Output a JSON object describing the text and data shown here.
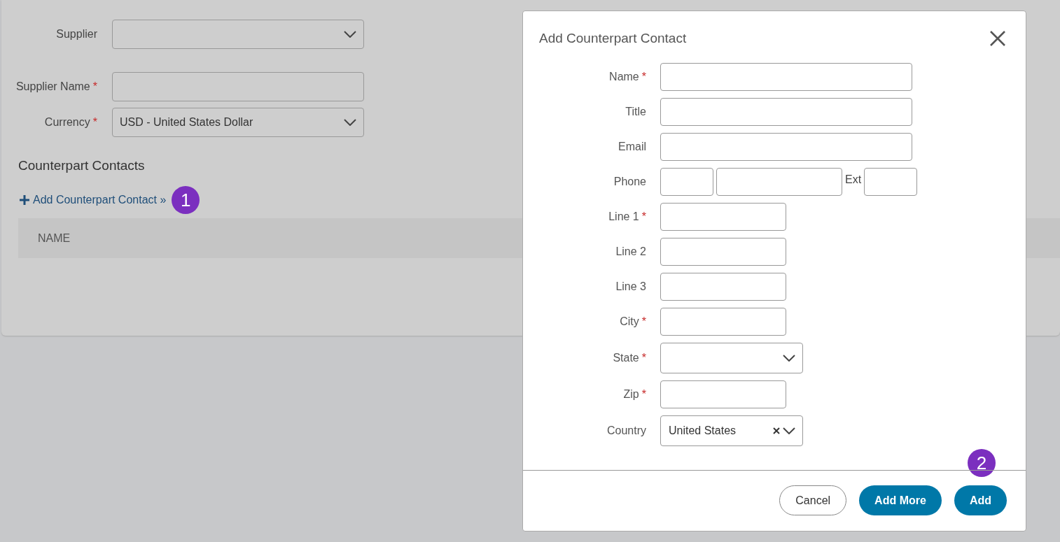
{
  "required_mark": "*",
  "form": {
    "fields": [
      {
        "label": "Supplier",
        "kind": "select",
        "required": false
      },
      {
        "label": "Supplier Name",
        "kind": "text",
        "required": true
      },
      {
        "label": "Currency",
        "kind": "select",
        "required": true,
        "value": "USD - United States Dollar"
      }
    ]
  },
  "contacts": {
    "heading": "Counterpart Contacts",
    "add_link": "Add Counterpart Contact »",
    "step_badge": "1",
    "table": {
      "columns": [
        "NAME"
      ]
    }
  },
  "dialog": {
    "title": "Add Counterpart Contact",
    "fields": [
      {
        "label": "Name",
        "kind": "wide",
        "required": true
      },
      {
        "label": "Title",
        "kind": "wide",
        "required": false
      },
      {
        "label": "Email",
        "kind": "wide",
        "required": false
      },
      {
        "label": "Phone",
        "kind": "phone",
        "required": false,
        "ext_label": "Ext"
      },
      {
        "label": "Line 1",
        "kind": "narrow",
        "required": true
      },
      {
        "label": "Line 2",
        "kind": "narrow",
        "required": false
      },
      {
        "label": "Line 3",
        "kind": "narrow",
        "required": false
      },
      {
        "label": "City",
        "kind": "narrow",
        "required": true
      },
      {
        "label": "State",
        "kind": "select",
        "required": true
      },
      {
        "label": "Zip",
        "kind": "narrow",
        "required": true
      },
      {
        "label": "Country",
        "kind": "clearable-select",
        "required": false,
        "value": "United States"
      }
    ],
    "step_badge": "2",
    "buttons": [
      {
        "label": "Cancel",
        "kind": "secondary"
      },
      {
        "label": "Add More",
        "kind": "primary"
      },
      {
        "label": "Add",
        "kind": "primary"
      }
    ]
  }
}
